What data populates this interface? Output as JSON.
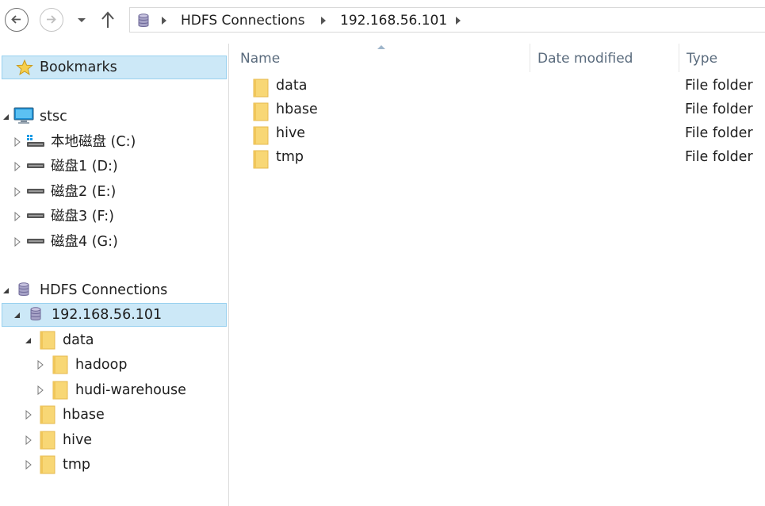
{
  "breadcrumb": {
    "items": [
      "HDFS Connections",
      "192.168.56.101"
    ]
  },
  "nav_tree": {
    "bookmarks": "Bookmarks",
    "computer": "stsc",
    "drives": [
      "本地磁盘 (C:)",
      "磁盘1 (D:)",
      "磁盘2 (E:)",
      "磁盘3 (F:)",
      "磁盘4 (G:)"
    ],
    "hdfs_root": "HDFS Connections",
    "host": "192.168.56.101",
    "folders": {
      "data": "data",
      "data_children": [
        "hadoop",
        "hudi-warehouse"
      ],
      "hbase": "hbase",
      "hive": "hive",
      "tmp": "tmp"
    }
  },
  "file_list": {
    "columns": {
      "name": "Name",
      "date": "Date modified",
      "type": "Type"
    },
    "rows": [
      {
        "name": "data",
        "date": "",
        "type": "File folder"
      },
      {
        "name": "hbase",
        "date": "",
        "type": "File folder"
      },
      {
        "name": "hive",
        "date": "",
        "type": "File folder"
      },
      {
        "name": "tmp",
        "date": "",
        "type": "File folder"
      }
    ]
  },
  "icons": {
    "back": "back-arrow-icon",
    "forward": "forward-arrow-icon",
    "recent": "chevron-down-icon",
    "up": "up-arrow-icon",
    "database": "database-icon",
    "folder": "folder-icon",
    "star": "star-icon",
    "computer": "computer-icon",
    "drive": "drive-icon",
    "system_drive": "system-drive-icon",
    "expand": "expand-triangle-icon",
    "collapse": "collapse-triangle-icon",
    "sort": "sort-ascending-icon",
    "separator": "breadcrumb-separator-icon"
  },
  "colors": {
    "selection_bg": "#cce8f7",
    "selection_border": "#99d1ef",
    "folder": "#f8d775",
    "folder_edge": "#e6b84d",
    "header_text": "#5a6b7d"
  }
}
